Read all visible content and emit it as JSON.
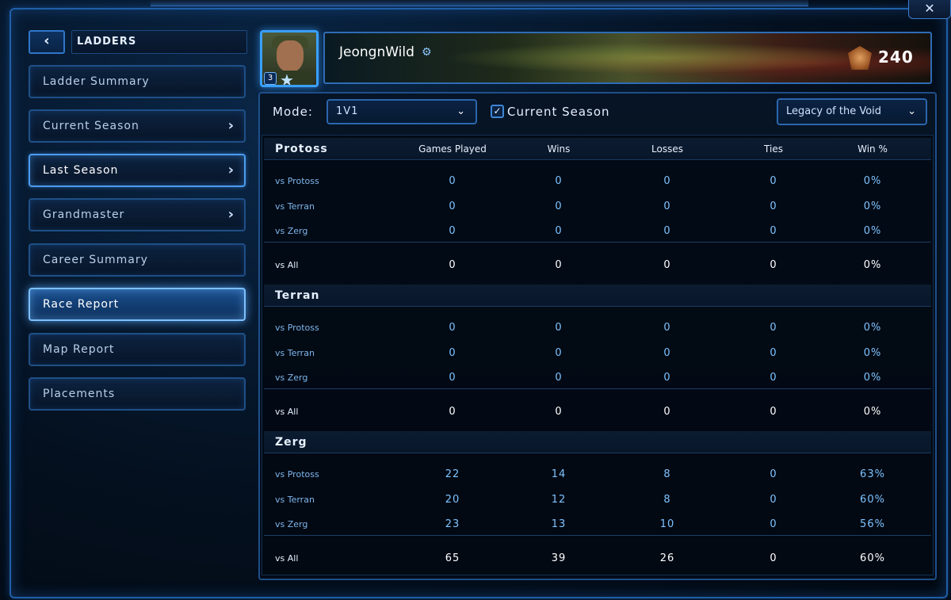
{
  "nav": {
    "title": "LADDERS",
    "back_glyph": "‹",
    "items": [
      {
        "label": "Ladder Summary",
        "chevron": false
      },
      {
        "label": "Current Season",
        "chevron": true
      },
      {
        "label": "Last Season",
        "chevron": true
      },
      {
        "label": "Grandmaster",
        "chevron": true
      },
      {
        "label": "Career Summary",
        "chevron": false
      },
      {
        "label": "Race Report",
        "chevron": false,
        "active": true
      },
      {
        "label": "Map Report",
        "chevron": false
      },
      {
        "label": "Placements",
        "chevron": false
      }
    ]
  },
  "window": {
    "close_glyph": "✕"
  },
  "profile": {
    "name": "JeongnWild",
    "level_badge": "3",
    "rank_points": "240"
  },
  "filters": {
    "mode_label": "Mode:",
    "mode_value": "1V1",
    "current_season_label": "Current Season",
    "current_season_checked": true,
    "expansion_value": "Legacy of the Void"
  },
  "table": {
    "columns": [
      "Games Played",
      "Wins",
      "Losses",
      "Ties",
      "Win %"
    ],
    "sections": [
      {
        "race": "Protoss",
        "rows": [
          {
            "label": "vs Protoss",
            "values": [
              "0",
              "0",
              "0",
              "0",
              "0%"
            ]
          },
          {
            "label": "vs Terran",
            "values": [
              "0",
              "0",
              "0",
              "0",
              "0%"
            ]
          },
          {
            "label": "vs Zerg",
            "values": [
              "0",
              "0",
              "0",
              "0",
              "0%"
            ]
          }
        ],
        "total": {
          "label": "vs All",
          "values": [
            "0",
            "0",
            "0",
            "0",
            "0%"
          ]
        }
      },
      {
        "race": "Terran",
        "rows": [
          {
            "label": "vs Protoss",
            "values": [
              "0",
              "0",
              "0",
              "0",
              "0%"
            ]
          },
          {
            "label": "vs Terran",
            "values": [
              "0",
              "0",
              "0",
              "0",
              "0%"
            ]
          },
          {
            "label": "vs Zerg",
            "values": [
              "0",
              "0",
              "0",
              "0",
              "0%"
            ]
          }
        ],
        "total": {
          "label": "vs All",
          "values": [
            "0",
            "0",
            "0",
            "0",
            "0%"
          ]
        }
      },
      {
        "race": "Zerg",
        "rows": [
          {
            "label": "vs Protoss",
            "values": [
              "22",
              "14",
              "8",
              "0",
              "63%"
            ]
          },
          {
            "label": "vs Terran",
            "values": [
              "20",
              "12",
              "8",
              "0",
              "60%"
            ]
          },
          {
            "label": "vs Zerg",
            "values": [
              "23",
              "13",
              "10",
              "0",
              "56%"
            ]
          }
        ],
        "total": {
          "label": "vs All",
          "values": [
            "65",
            "39",
            "26",
            "0",
            "60%"
          ]
        }
      }
    ]
  }
}
